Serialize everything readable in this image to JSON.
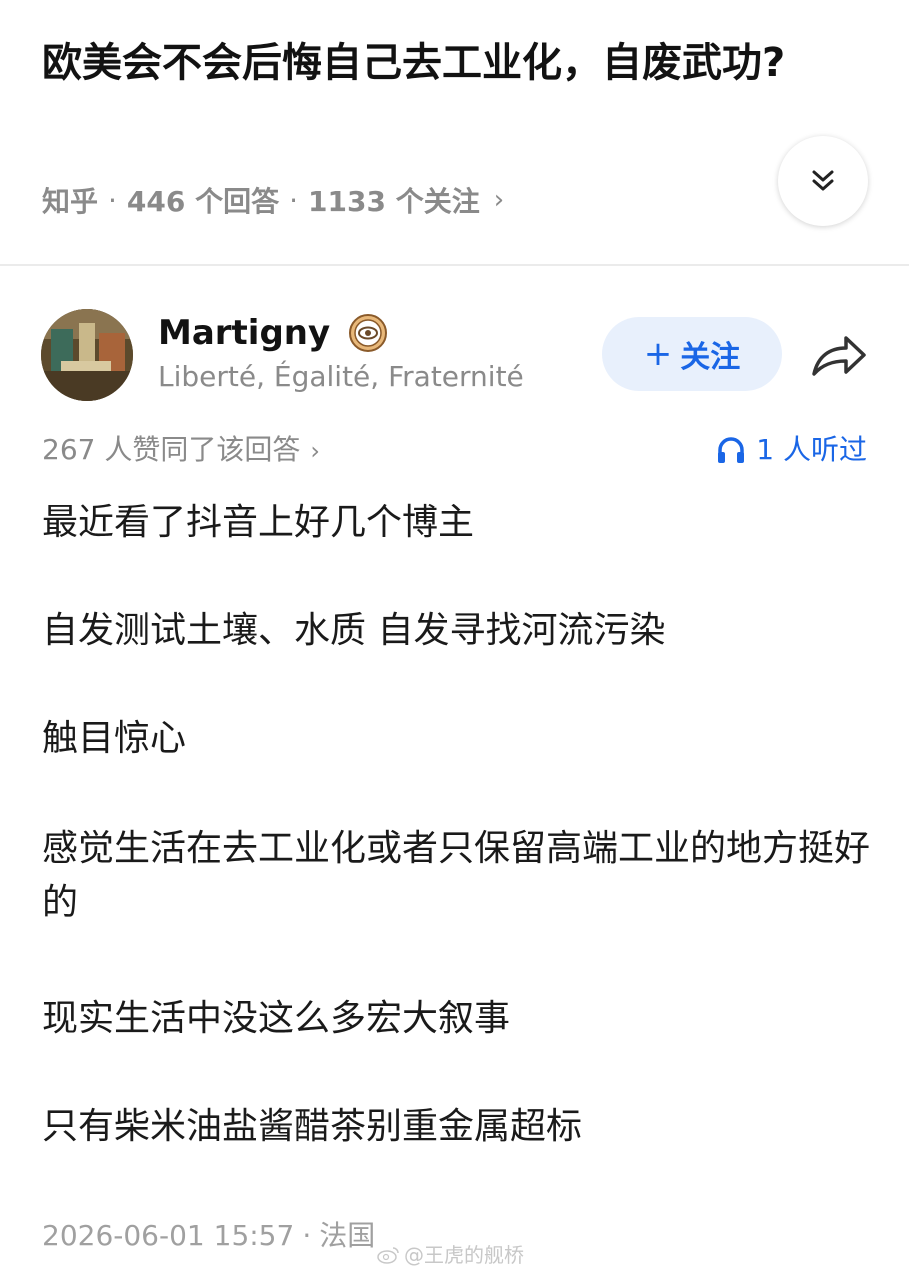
{
  "question": {
    "title": "欧美会不会后悔自己去工业化，自废武功?",
    "source": "知乎",
    "answers_count": "446 个回答",
    "followers_count": "1133 个关注",
    "expand_icon": "double-chevron-down-icon"
  },
  "author": {
    "name": "Martigny",
    "bio": "Liberté, Égalité, Fraternité",
    "badge_icon": "eye-badge-icon",
    "follow_label": "关注",
    "follow_plus": "+",
    "share_icon": "share-arrow-icon"
  },
  "stats": {
    "votes": "267 人赞同了该回答",
    "listened": "1 人听过",
    "listen_icon": "headphones-icon",
    "accent_color": "#1a66e6"
  },
  "answer": {
    "paragraphs": [
      "最近看了抖音上好几个博主",
      "自发测试土壤、水质 自发寻找河流污染",
      "触目惊心",
      "感觉生活在去工业化或者只保留高端工业的地方挺好的",
      "现实生活中没这么多宏大叙事",
      "只有柴米油盐酱醋茶别重金属超标"
    ]
  },
  "footer": {
    "date": "2026-06-01 15:57",
    "location": "法国",
    "watermark": "@王虎的舰桥"
  }
}
